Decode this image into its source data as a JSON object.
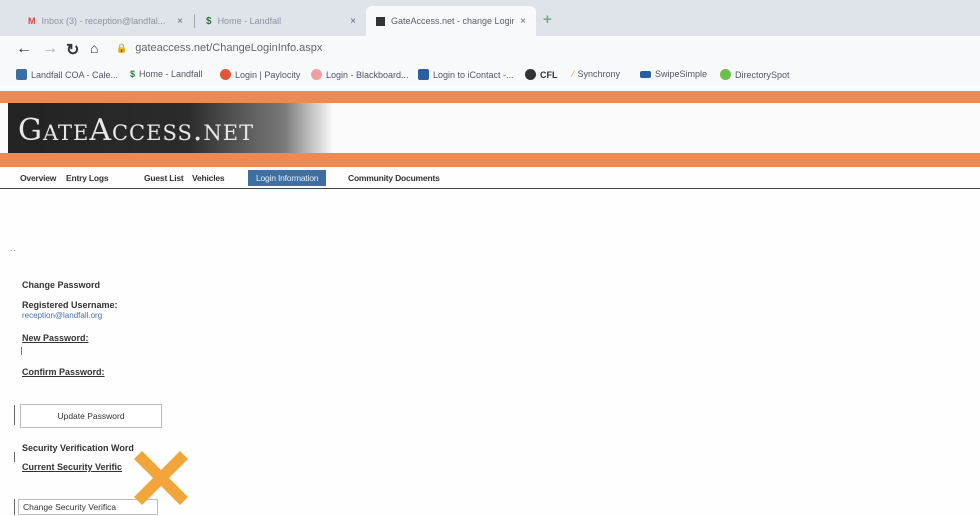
{
  "browser": {
    "tabs": [
      {
        "title": "Inbox (3) - reception@landfal...",
        "close": "×"
      },
      {
        "title": "Home - Landfall",
        "close": "×"
      },
      {
        "title": "GateAccess.net - change Login",
        "close": "×"
      }
    ],
    "new_tab": "+",
    "url": "gateaccess.net/ChangeLoginInfo.aspx",
    "bookmarks": [
      "Landfall COA - Cale...",
      "Home - Landfall",
      "Login | Paylocity",
      "Login - Blackboard...",
      "Login to iContact -...",
      "CFL",
      "Synchrony",
      "SwipeSimple",
      "DirectorySpot"
    ]
  },
  "site": {
    "logo": "GateAccess.net",
    "nav": [
      "Overview",
      "Entry Logs",
      "Guest List",
      "Vehicles",
      "Login Information",
      "Community Documents"
    ],
    "active_nav": "Login Information"
  },
  "form": {
    "dots": "..",
    "change_password_title": "Change Password",
    "registered_username_label": "Registered Username:",
    "registered_username_value": "reception@landfall.org",
    "new_password_label": "New Password:",
    "confirm_password_label": "Confirm Password:",
    "update_password_button": "Update Password",
    "security_word_title": "Security Verification Word",
    "current_security_label": "Current Security Verific",
    "change_security_button": "Change Security Verifica"
  },
  "colors": {
    "orange": "#ec8a54",
    "nav_active": "#3d6fa3",
    "x_mark": "#f2a53a"
  }
}
